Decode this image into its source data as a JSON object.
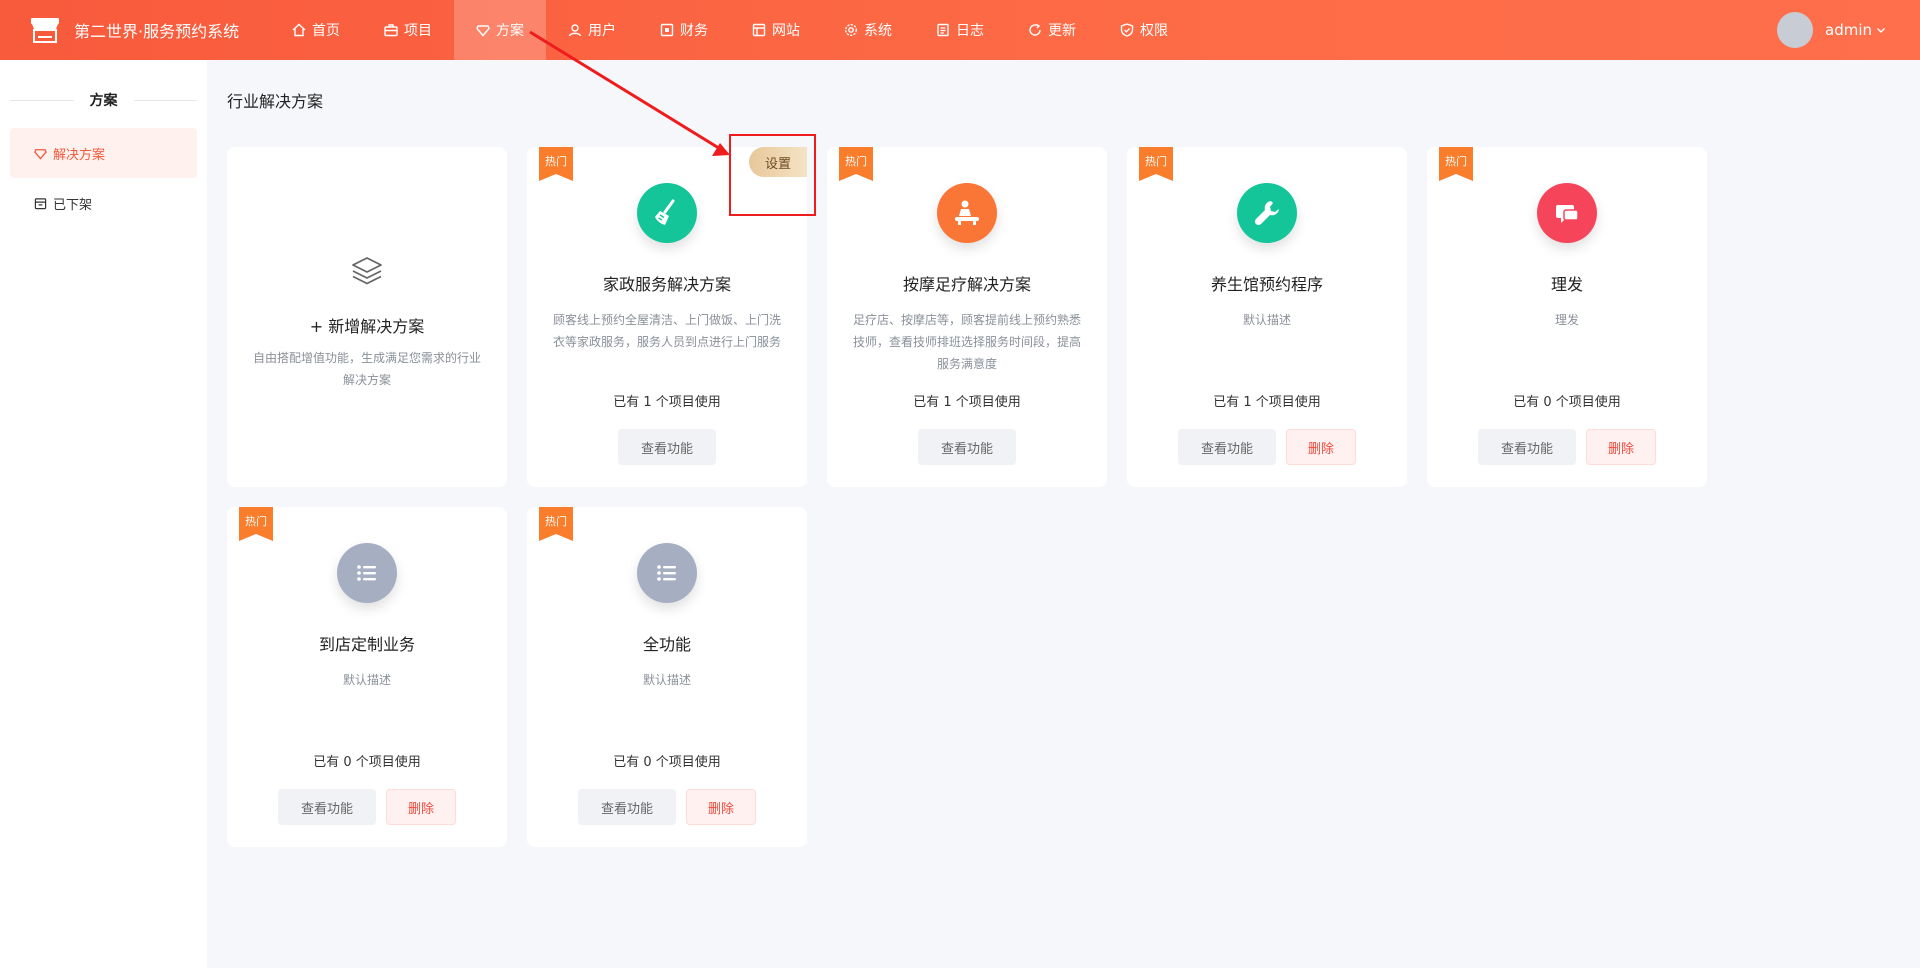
{
  "header": {
    "title": "第二世界·服务预约系统",
    "nav": [
      {
        "label": "首页",
        "icon": "home-icon"
      },
      {
        "label": "项目",
        "icon": "briefcase-icon"
      },
      {
        "label": "方案",
        "icon": "heart-shield-icon"
      },
      {
        "label": "用户",
        "icon": "user-icon"
      },
      {
        "label": "财务",
        "icon": "wallet-icon"
      },
      {
        "label": "网站",
        "icon": "layout-icon"
      },
      {
        "label": "系统",
        "icon": "gear-icon"
      },
      {
        "label": "日志",
        "icon": "document-icon"
      },
      {
        "label": "更新",
        "icon": "refresh-icon"
      },
      {
        "label": "权限",
        "icon": "shield-icon"
      }
    ],
    "active_nav": "方案",
    "user": {
      "name": "admin"
    }
  },
  "sidebar": {
    "heading": "方案",
    "items": [
      {
        "label": "解决方案",
        "icon": "heart-shield-icon",
        "active": true
      },
      {
        "label": "已下架",
        "icon": "archive-icon",
        "active": false
      }
    ]
  },
  "main": {
    "title": "行业解决方案",
    "add_card": {
      "title": "+ 新增解决方案",
      "desc": "自由搭配增值功能，生成满足您需求的行业解决方案"
    },
    "hot_label": "热门",
    "view_label": "查看功能",
    "delete_label": "删除",
    "settings_label": "设置",
    "cards": [
      {
        "title": "家政服务解决方案",
        "desc": "顾客线上预约全屋清洁、上门做饭、上门洗衣等家政服务，服务人员到点进行上门服务",
        "usage": "已有 1 个项目使用",
        "icon": "broom-icon",
        "color": "#14c59a",
        "deletable": false
      },
      {
        "title": "按摩足疗解决方案",
        "desc": "足疗店、按摩店等，顾客提前线上预约熟悉技师，查看技师排班选择服务时间段，提高服务满意度",
        "usage": "已有 1 个项目使用",
        "icon": "massage-icon",
        "color": "#f97636",
        "deletable": false
      },
      {
        "title": "养生馆预约程序",
        "desc": "默认描述",
        "usage": "已有 1 个项目使用",
        "icon": "wrench-icon",
        "color": "#14c59a",
        "deletable": true
      },
      {
        "title": "理发",
        "desc": "理发",
        "usage": "已有 0 个项目使用",
        "icon": "chat-bubble-icon",
        "color": "#f6455b",
        "deletable": true
      },
      {
        "title": "到店定制业务",
        "desc": "默认描述",
        "usage": "已有 0 个项目使用",
        "icon": "list-icon",
        "color": "#a6afc2",
        "deletable": true
      },
      {
        "title": "全功能",
        "desc": "默认描述",
        "usage": "已有 0 个项目使用",
        "icon": "list-icon",
        "color": "#a6afc2",
        "deletable": true
      }
    ]
  }
}
